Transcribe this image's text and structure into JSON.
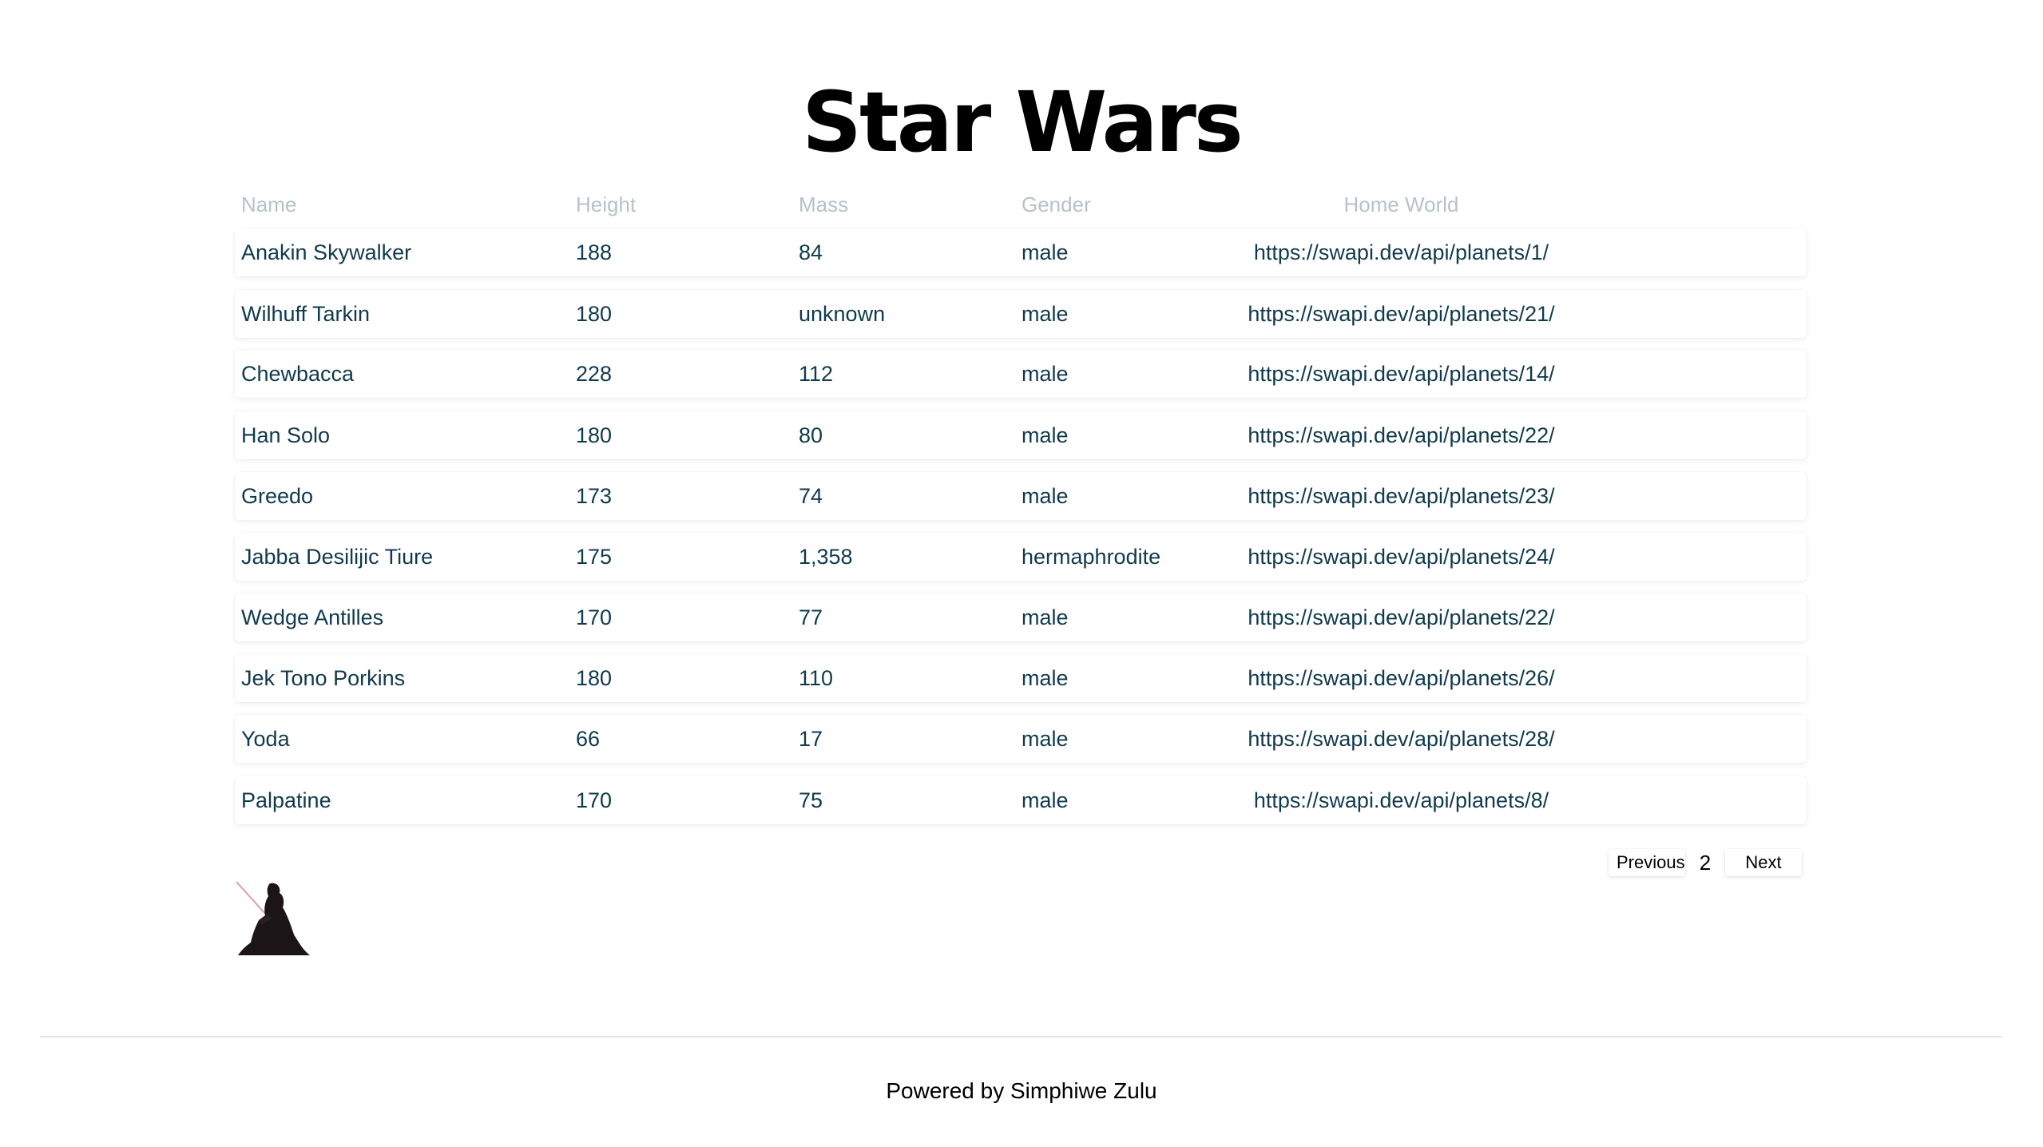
{
  "header": {
    "title": "Star Wars"
  },
  "table": {
    "columns": {
      "name": "Name",
      "height": "Height",
      "mass": "Mass",
      "gender": "Gender",
      "home_world": "Home World"
    },
    "rows": [
      {
        "name": "Anakin Skywalker",
        "height": "188",
        "mass": "84",
        "gender": "male",
        "home_world": "https://swapi.dev/api/planets/1/"
      },
      {
        "name": "Wilhuff Tarkin",
        "height": "180",
        "mass": "unknown",
        "gender": "male",
        "home_world": "https://swapi.dev/api/planets/21/"
      },
      {
        "name": "Chewbacca",
        "height": "228",
        "mass": "112",
        "gender": "male",
        "home_world": "https://swapi.dev/api/planets/14/"
      },
      {
        "name": "Han Solo",
        "height": "180",
        "mass": "80",
        "gender": "male",
        "home_world": "https://swapi.dev/api/planets/22/"
      },
      {
        "name": "Greedo",
        "height": "173",
        "mass": "74",
        "gender": "male",
        "home_world": "https://swapi.dev/api/planets/23/"
      },
      {
        "name": "Jabba Desilijic Tiure",
        "height": "175",
        "mass": "1,358",
        "gender": "hermaphrodite",
        "home_world": "https://swapi.dev/api/planets/24/"
      },
      {
        "name": "Wedge Antilles",
        "height": "170",
        "mass": "77",
        "gender": "male",
        "home_world": "https://swapi.dev/api/planets/22/"
      },
      {
        "name": "Jek Tono Porkins",
        "height": "180",
        "mass": "110",
        "gender": "male",
        "home_world": "https://swapi.dev/api/planets/26/"
      },
      {
        "name": "Yoda",
        "height": "66",
        "mass": "17",
        "gender": "male",
        "home_world": "https://swapi.dev/api/planets/28/"
      },
      {
        "name": "Palpatine",
        "height": "170",
        "mass": "75",
        "gender": "male",
        "home_world": "https://swapi.dev/api/planets/8/"
      }
    ]
  },
  "pagination": {
    "previous_label": "Previous",
    "current_page": "2",
    "next_label": "Next"
  },
  "figure": {
    "icon": "sith-lightsaber-silhouette-icon"
  },
  "footer": {
    "text": "Powered by Simphiwe Zulu"
  }
}
